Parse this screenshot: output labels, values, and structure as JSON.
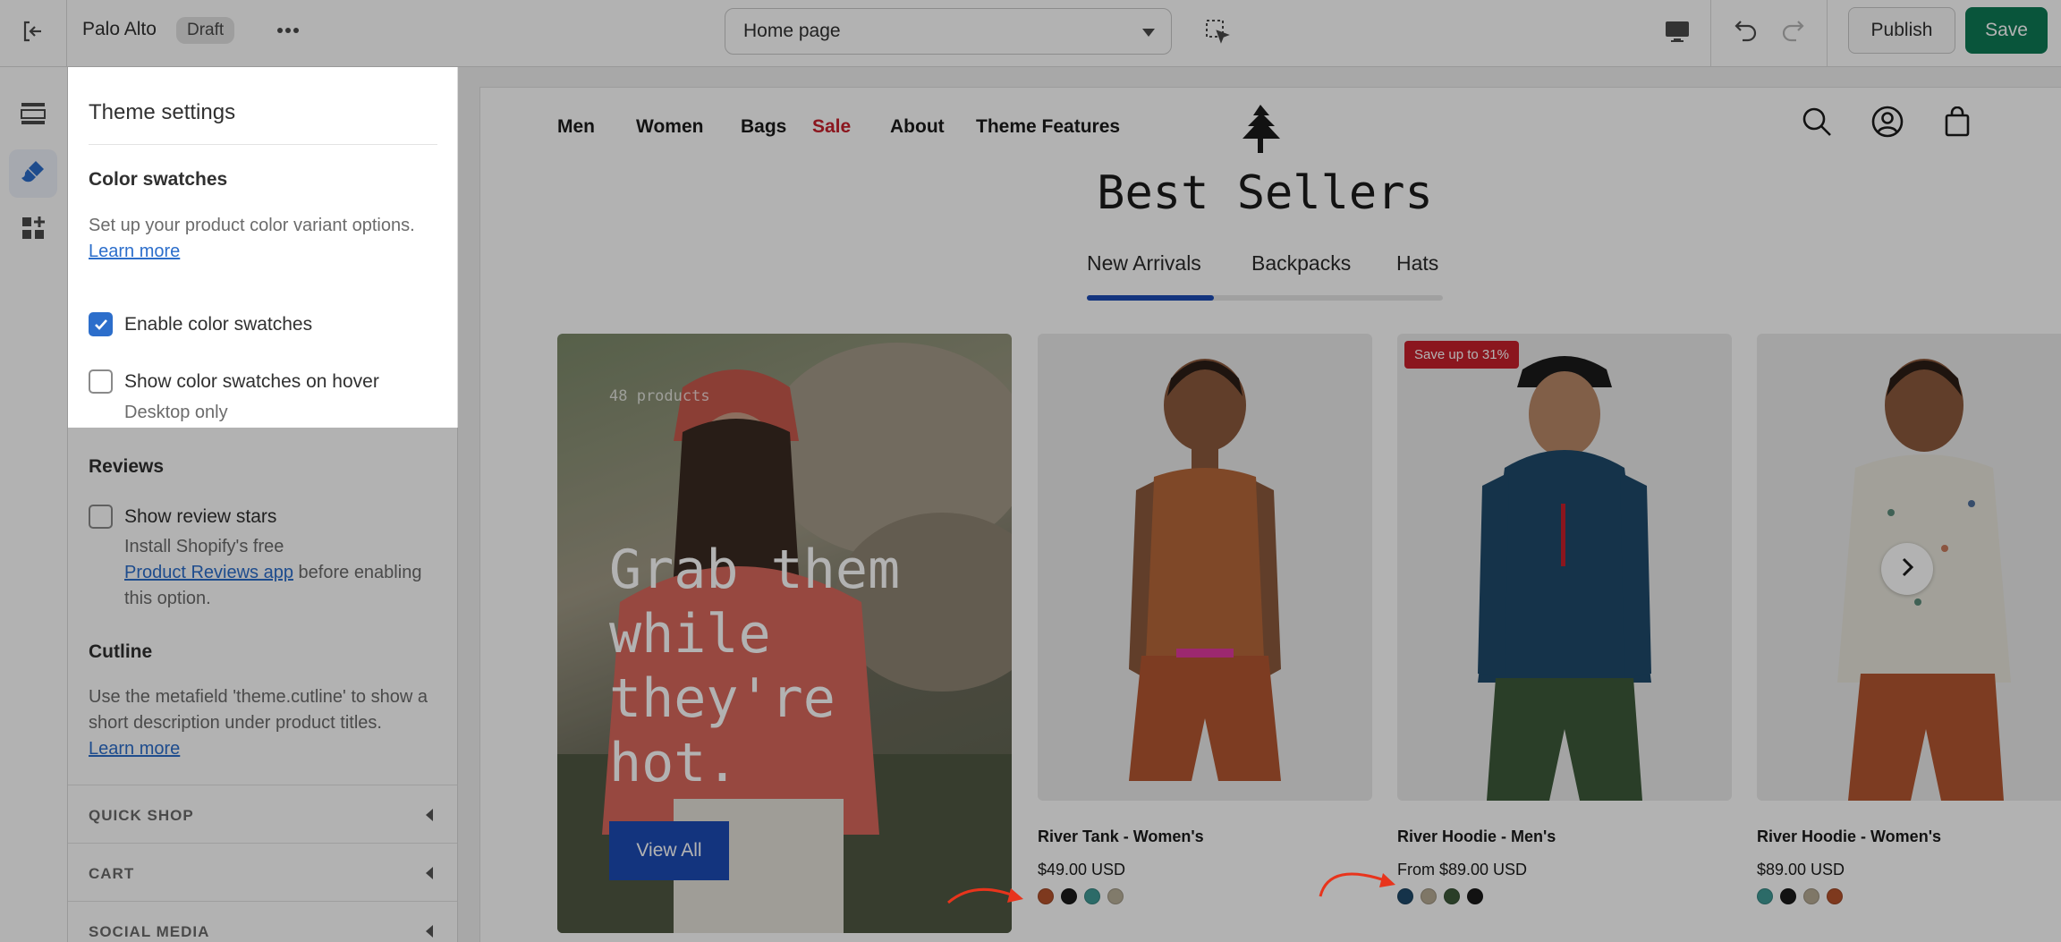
{
  "topbar": {
    "store_name": "Palo Alto",
    "status_badge": "Draft",
    "page_selector": "Home page",
    "publish_label": "Publish",
    "save_label": "Save"
  },
  "sidebar": {
    "title": "Theme settings",
    "color_swatches": {
      "heading": "Color swatches",
      "help_text": "Set up your product color variant options.",
      "help_link": "Learn more",
      "enable_label": "Enable color swatches",
      "enable_checked": true,
      "hover_label": "Show color swatches on hover",
      "hover_checked": false,
      "hover_note": "Desktop only"
    },
    "reviews": {
      "heading": "Reviews",
      "stars_label": "Show review stars",
      "stars_checked": false,
      "note_prefix": "Install Shopify's free",
      "note_link": "Product Reviews app",
      "note_suffix": "before enabling this option."
    },
    "cutline": {
      "heading": "Cutline",
      "help_text": "Use the metafield 'theme.cutline' to show a short description under product titles.",
      "help_link": "Learn more"
    },
    "accordions": [
      "QUICK SHOP",
      "CART",
      "SOCIAL MEDIA"
    ]
  },
  "store": {
    "nav": [
      "Men",
      "Women",
      "Bags",
      "Sale",
      "About",
      "Theme Features"
    ],
    "section_title": "Best Sellers",
    "tabs": [
      "New Arrivals",
      "Backpacks",
      "Hats"
    ],
    "active_tab": 0,
    "hero": {
      "count": "48 products",
      "title": "Grab them while they're hot.",
      "button": "View All"
    },
    "products": [
      {
        "title": "River Tank - Women's",
        "price": "$49.00 USD",
        "badge": "",
        "swatches": [
          "#b5522b",
          "#1a1a1a",
          "#3f9a96",
          "#b9b09a"
        ]
      },
      {
        "title": "River Hoodie - Men's",
        "price": "From $89.00 USD",
        "badge": "Save up to 31%",
        "swatches": [
          "#1f4a6b",
          "#b7ab94",
          "#3d5a3a",
          "#1a1a1a"
        ]
      },
      {
        "title": "River Hoodie - Women's",
        "price": "$89.00 USD",
        "badge": "",
        "swatches": [
          "#3f9a96",
          "#1a1a1a",
          "#b7ab94",
          "#b5522b"
        ]
      }
    ]
  },
  "colors": {
    "accent_blue": "#2c6ecb",
    "save_green": "#0d7a55",
    "sale_red": "#c8202b",
    "store_blue": "#1c4bb5",
    "arrow_red": "#e8341c"
  }
}
